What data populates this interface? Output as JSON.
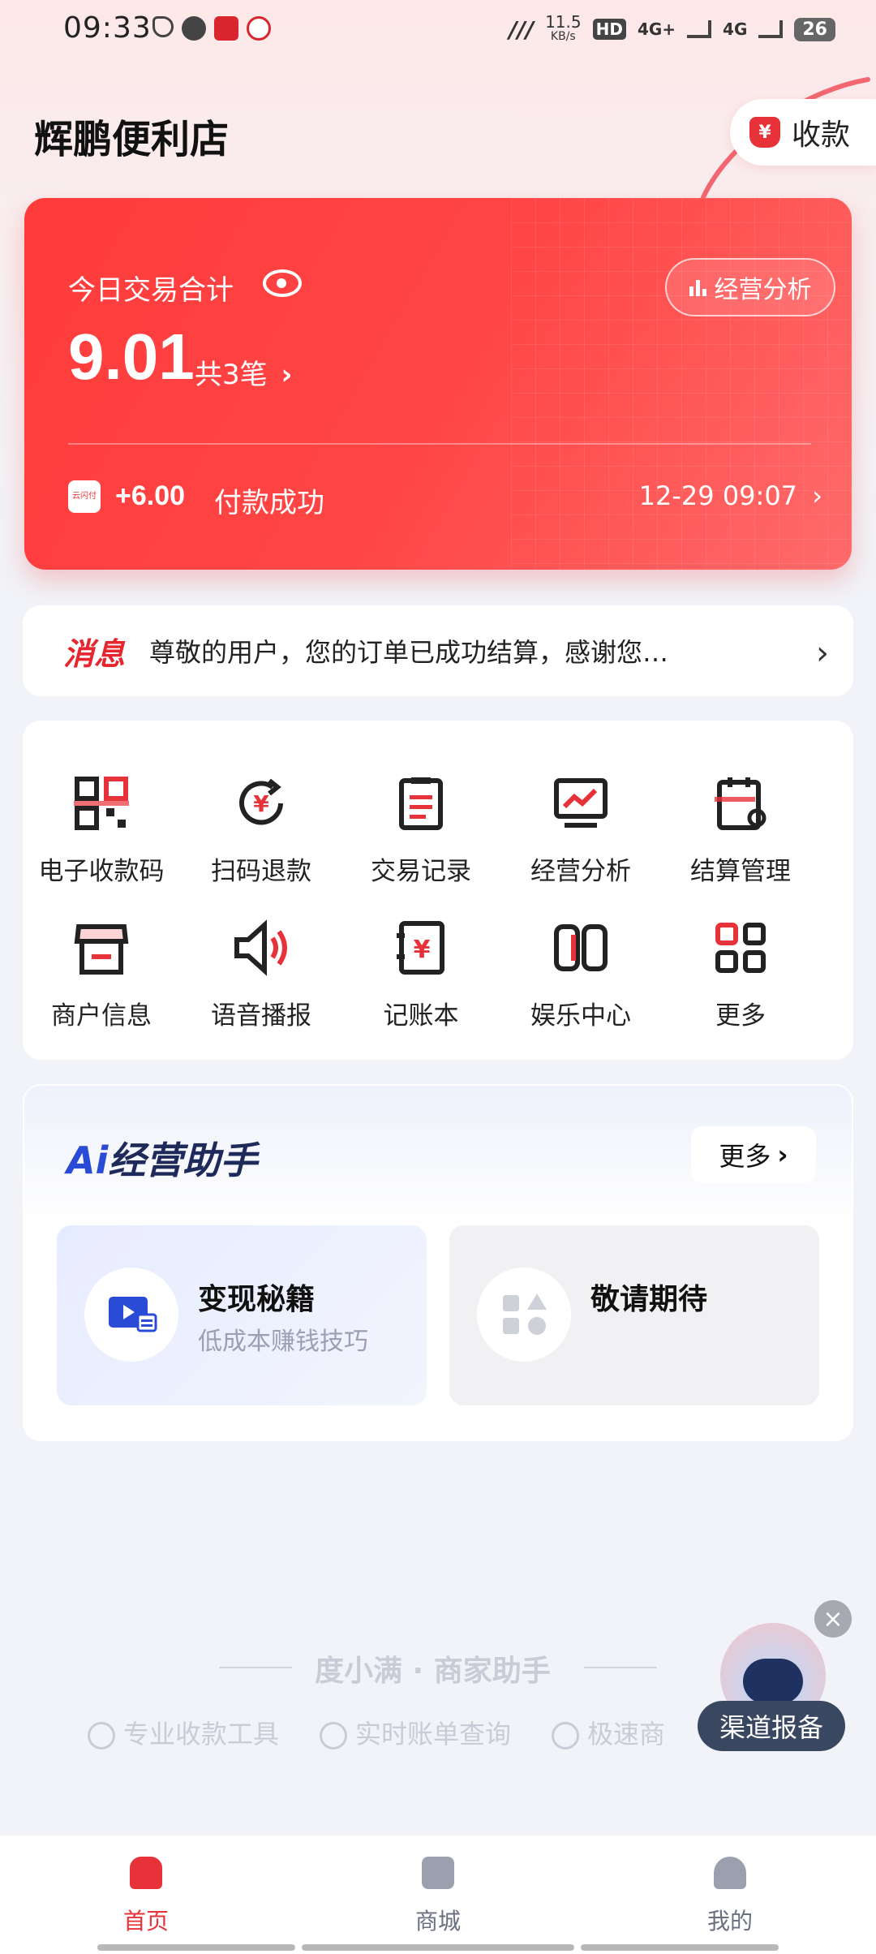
{
  "status_bar": {
    "time": "09:33",
    "speed_top": "11.5",
    "speed_unit": "KB/s",
    "hd": "HD",
    "net1": "4G+",
    "net2": "4G",
    "battery": "26"
  },
  "header": {
    "store_name": "辉鹏便利店",
    "collect_label": "收款"
  },
  "summary_card": {
    "label": "今日交易合计",
    "amount": "9.01",
    "count": "共3笔",
    "analysis_label": "经营分析",
    "latest": {
      "pay_icon_text": "云闪付",
      "amount": "+6.00",
      "status": "付款成功",
      "time": "12-29 09:07"
    }
  },
  "notice": {
    "tag": "消息",
    "message": "尊敬的用户，您的订单已成功结算，感谢您…"
  },
  "menu": {
    "items": [
      {
        "label": "电子收款码",
        "icon": "qr-code-icon"
      },
      {
        "label": "扫码退款",
        "icon": "refund-icon"
      },
      {
        "label": "交易记录",
        "icon": "record-icon"
      },
      {
        "label": "经营分析",
        "icon": "analysis-icon"
      },
      {
        "label": "结算管理",
        "icon": "settlement-icon"
      },
      {
        "label": "商户信息",
        "icon": "store-icon"
      },
      {
        "label": "语音播报",
        "icon": "speaker-icon"
      },
      {
        "label": "记账本",
        "icon": "ledger-icon"
      },
      {
        "label": "娱乐中心",
        "icon": "game-icon"
      },
      {
        "label": "更多",
        "icon": "grid-icon"
      }
    ]
  },
  "ai_assistant": {
    "logo_prefix": "Ai",
    "logo_text": "经营助手",
    "more_label": "更多",
    "tiles": [
      {
        "title": "变现秘籍",
        "subtitle": "低成本赚钱技巧"
      },
      {
        "title": "敬请期待",
        "subtitle": ""
      }
    ]
  },
  "brand": {
    "slogan": "度小满 · 商家助手",
    "features": [
      "专业收款工具",
      "实时账单查询",
      "极速商"
    ]
  },
  "floating": {
    "channel_label": "渠道报备"
  },
  "bottom_nav": {
    "items": [
      {
        "label": "首页",
        "active": true
      },
      {
        "label": "商城",
        "active": false
      },
      {
        "label": "我的",
        "active": false
      }
    ]
  },
  "colors": {
    "accent": "#e8323a",
    "card_red": "#ff3b3b",
    "nav_active": "#e8323a",
    "nav_inactive": "#8a8f9c"
  }
}
